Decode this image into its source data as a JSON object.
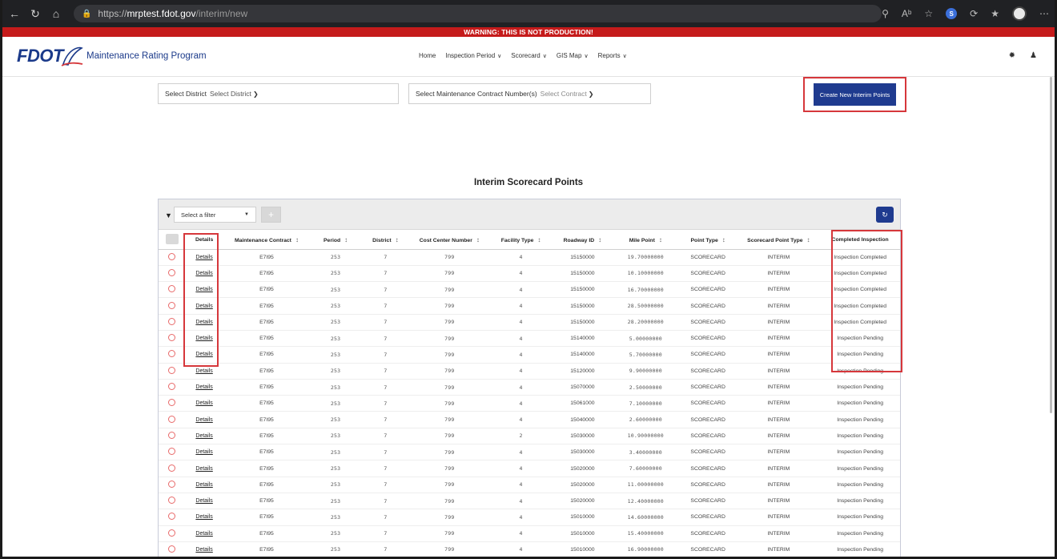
{
  "browser": {
    "url_prefix": "https://",
    "url_host": "mrptest.fdot.gov",
    "url_path": "/interim/new"
  },
  "banner": {
    "warning_text": "WARNING: THIS IS NOT PRODUCTION!"
  },
  "header": {
    "logo_text": "FDOT",
    "app_title": "Maintenance Rating Program",
    "nav": [
      {
        "label": "Home",
        "has_menu": false
      },
      {
        "label": "Inspection Period",
        "has_menu": true
      },
      {
        "label": "Scorecard",
        "has_menu": true
      },
      {
        "label": "GIS Map",
        "has_menu": true
      },
      {
        "label": "Reports",
        "has_menu": true
      }
    ]
  },
  "filters": {
    "district_label": "Select District",
    "district_value": "Select District",
    "contract_label": "Select Maintenance Contract Number(s)",
    "contract_value": "Select Contract",
    "create_button": "Create New Interim Points"
  },
  "section_title": "Interim Scorecard Points",
  "table": {
    "filter_placeholder": "Select a filter",
    "columns": [
      "Details",
      "Maintenance Contract",
      "Period",
      "District",
      "Cost Center Number",
      "Facility Type",
      "Roadway ID",
      "Mile Point",
      "Point Type",
      "Scorecard Point Type",
      "Completed Inspection"
    ],
    "rows": [
      [
        "Details",
        "E7I95",
        "253",
        "7",
        "799",
        "4",
        "15150000",
        "19.70000000",
        "SCORECARD",
        "INTERIM",
        "Inspection Completed"
      ],
      [
        "Details",
        "E7I95",
        "253",
        "7",
        "799",
        "4",
        "15150000",
        "10.10000000",
        "SCORECARD",
        "INTERIM",
        "Inspection Completed"
      ],
      [
        "Details",
        "E7I95",
        "253",
        "7",
        "799",
        "4",
        "15150000",
        "16.70000000",
        "SCORECARD",
        "INTERIM",
        "Inspection Completed"
      ],
      [
        "Details",
        "E7I95",
        "253",
        "7",
        "799",
        "4",
        "15150000",
        "28.50000000",
        "SCORECARD",
        "INTERIM",
        "Inspection Completed"
      ],
      [
        "Details",
        "E7I95",
        "253",
        "7",
        "799",
        "4",
        "15150000",
        "28.20000000",
        "SCORECARD",
        "INTERIM",
        "Inspection Completed"
      ],
      [
        "Details",
        "E7I95",
        "253",
        "7",
        "799",
        "4",
        "15140000",
        "5.00000000",
        "SCORECARD",
        "INTERIM",
        "Inspection Pending"
      ],
      [
        "Details",
        "E7I95",
        "253",
        "7",
        "799",
        "4",
        "15140000",
        "5.70000000",
        "SCORECARD",
        "INTERIM",
        "Inspection Pending"
      ],
      [
        "Details",
        "E7I95",
        "253",
        "7",
        "799",
        "4",
        "15120000",
        "9.90000000",
        "SCORECARD",
        "INTERIM",
        "Inspection Pending"
      ],
      [
        "Details",
        "E7I95",
        "253",
        "7",
        "799",
        "4",
        "15070000",
        "2.50000000",
        "SCORECARD",
        "INTERIM",
        "Inspection Pending"
      ],
      [
        "Details",
        "E7I95",
        "253",
        "7",
        "799",
        "4",
        "15061000",
        "7.10000000",
        "SCORECARD",
        "INTERIM",
        "Inspection Pending"
      ],
      [
        "Details",
        "E7I95",
        "253",
        "7",
        "799",
        "4",
        "15040000",
        "2.60000000",
        "SCORECARD",
        "INTERIM",
        "Inspection Pending"
      ],
      [
        "Details",
        "E7I95",
        "253",
        "7",
        "799",
        "2",
        "15030000",
        "10.90000000",
        "SCORECARD",
        "INTERIM",
        "Inspection Pending"
      ],
      [
        "Details",
        "E7I95",
        "253",
        "7",
        "799",
        "4",
        "15030000",
        "3.40000000",
        "SCORECARD",
        "INTERIM",
        "Inspection Pending"
      ],
      [
        "Details",
        "E7I95",
        "253",
        "7",
        "799",
        "4",
        "15020000",
        "7.60000000",
        "SCORECARD",
        "INTERIM",
        "Inspection Pending"
      ],
      [
        "Details",
        "E7I95",
        "253",
        "7",
        "799",
        "4",
        "15020000",
        "11.00000000",
        "SCORECARD",
        "INTERIM",
        "Inspection Pending"
      ],
      [
        "Details",
        "E7I95",
        "253",
        "7",
        "799",
        "4",
        "15020000",
        "12.40000000",
        "SCORECARD",
        "INTERIM",
        "Inspection Pending"
      ],
      [
        "Details",
        "E7I95",
        "253",
        "7",
        "799",
        "4",
        "15010000",
        "14.60000000",
        "SCORECARD",
        "INTERIM",
        "Inspection Pending"
      ],
      [
        "Details",
        "E7I95",
        "253",
        "7",
        "799",
        "4",
        "15010000",
        "15.40000000",
        "SCORECARD",
        "INTERIM",
        "Inspection Pending"
      ],
      [
        "Details",
        "E7I95",
        "253",
        "7",
        "799",
        "4",
        "15010000",
        "16.90000000",
        "SCORECARD",
        "INTERIM",
        "Inspection Pending"
      ]
    ]
  },
  "colors": {
    "brand_blue": "#1f3b8f",
    "warning_red": "#c51b1b",
    "highlight_red": "#d6373b"
  }
}
